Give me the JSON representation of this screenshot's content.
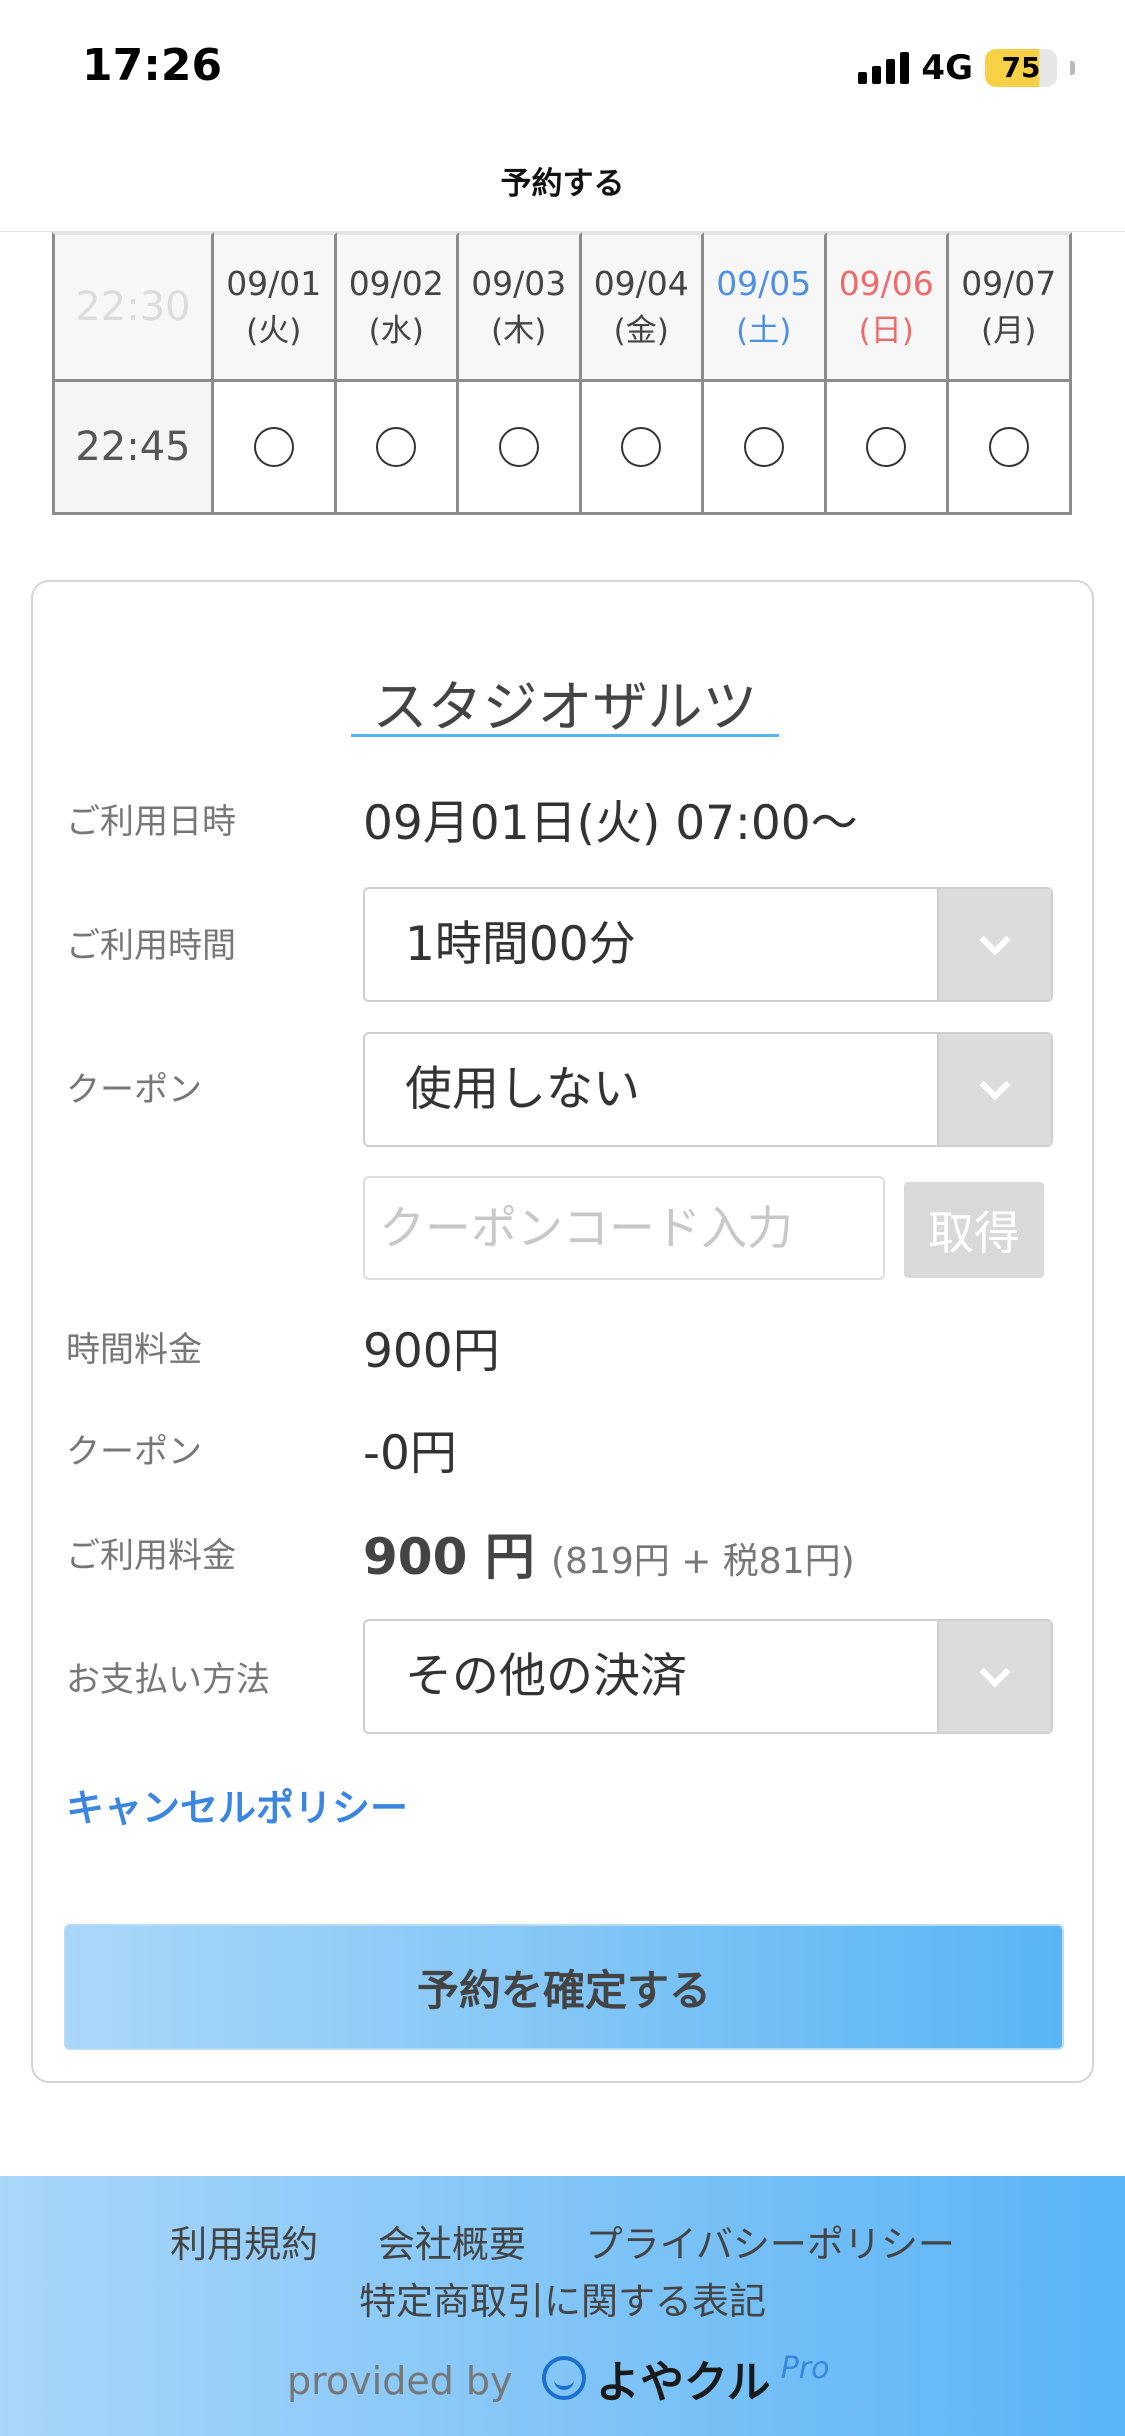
{
  "status_bar": {
    "time": "17:26",
    "network": "4G",
    "battery": "75",
    "battery_level": 0.75
  },
  "header": {
    "title": "予約する"
  },
  "schedule": {
    "header_time": "22:30",
    "days": [
      {
        "date": "09/01",
        "dow": "(火)",
        "kind": "weekday"
      },
      {
        "date": "09/02",
        "dow": "(水)",
        "kind": "weekday"
      },
      {
        "date": "09/03",
        "dow": "(木)",
        "kind": "weekday"
      },
      {
        "date": "09/04",
        "dow": "(金)",
        "kind": "weekday"
      },
      {
        "date": "09/05",
        "dow": "(土)",
        "kind": "saturday"
      },
      {
        "date": "09/06",
        "dow": "(日)",
        "kind": "sunday"
      },
      {
        "date": "09/07",
        "dow": "(月)",
        "kind": "weekday"
      }
    ],
    "rows": [
      {
        "time": "22:45",
        "slots": [
          "○",
          "○",
          "○",
          "○",
          "○",
          "○",
          "○"
        ]
      }
    ],
    "colors": {
      "saturday": "#4e8fe6",
      "sunday": "#ef6a6a"
    }
  },
  "booking": {
    "studio_name": "スタジオザルツ",
    "datetime_label": "ご利用日時",
    "datetime_value": "09月01日(火) 07:00〜",
    "duration_label": "ご利用時間",
    "duration_value": "1時間00分",
    "coupon_label": "クーポン",
    "coupon_value": "使用しない",
    "coupon_code_placeholder": "クーポンコード入力",
    "coupon_get_button": "取得",
    "time_fee_label": "時間料金",
    "time_fee_value": "900円",
    "coupon_discount_label": "クーポン",
    "coupon_discount_value": "-0円",
    "total_label": "ご利用料金",
    "total_value": "900 円",
    "total_breakdown": "(819円 + 税81円)",
    "payment_label": "お支払い方法",
    "payment_value": "その他の決済",
    "cancel_policy_link": "キャンセルポリシー",
    "confirm_button": "予約を確定する"
  },
  "footer": {
    "links": [
      "利用規約",
      "会社概要",
      "プライバシーポリシー"
    ],
    "link_second_line": "特定商取引に関する表記",
    "provided_by": "provided by",
    "brand_name": "よやクル",
    "brand_suffix": "Pro"
  },
  "colors": {
    "accent": "#3a86e0",
    "button_gradient_start": "#aad7f8",
    "button_gradient_end": "#5ab5f4"
  }
}
